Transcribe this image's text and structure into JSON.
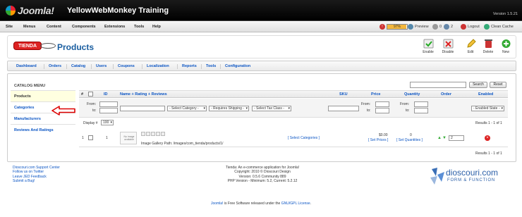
{
  "header": {
    "logo_text": "Joomla!",
    "site_title": "YellowWebMonkey Training",
    "version": "Version 1.5.21"
  },
  "menu": [
    "Site",
    "Menus",
    "Content",
    "Components",
    "Extensions",
    "Tools",
    "Help"
  ],
  "status": {
    "meter": "97%",
    "preview": "Preview",
    "messages": "0",
    "users": "2",
    "logout": "Logout",
    "clean_cache": "Clean Cache"
  },
  "toolbar": {
    "brand_label": "TIENDA",
    "page_title": "Products",
    "buttons": [
      "Enable",
      "Disable",
      "Edit",
      "Delete",
      "New"
    ]
  },
  "subnav": [
    "Dashboard",
    "Orders",
    "Catalog",
    "Users",
    "Coupons",
    "Localization",
    "Reports",
    "Tools",
    "Configuration"
  ],
  "catalog_menu": {
    "heading": "CATALOG MENU",
    "items": [
      "Products",
      "Categories",
      "Manufacturers",
      "Reviews And Ratings"
    ]
  },
  "search": {
    "search_btn": "Search",
    "reset_btn": "Reset"
  },
  "table": {
    "headers": {
      "num": "#",
      "id": "ID",
      "name": "Name + Rating + Reviews",
      "sku": "SKU",
      "price": "Price",
      "quantity": "Quantity",
      "order": "Order",
      "enabled": "Enabled"
    },
    "filters": {
      "from": "From:",
      "to": "to:",
      "category": "- Select Category -",
      "shipping": "- Requires Shipping -",
      "tax": "- Select Tax Class -",
      "enabled": "- Enabled State -"
    },
    "display": "Display #",
    "display_value": "100",
    "results": "Results 1 - 1 of 1",
    "row": {
      "num": "1",
      "id": "1",
      "thumb": "No image available",
      "gallery": "Image Gallery Path: /images/com_tienda/products/1/",
      "categories": "[ Select Categories ]",
      "price": "$0.00",
      "set_prices": "[ Set Prices ]",
      "qty": "0",
      "set_quantities": "[ Set Quantities ]",
      "order": "2"
    }
  },
  "footer": {
    "left": [
      "Dioscouri.com Support Center",
      "Follow us on Twitter",
      "Leave JED Feedback",
      "Submit a Bug!"
    ],
    "center": [
      "Tienda: An e-commerce application for Joomla!",
      "Copyright: 2010 © Dioscouri Design",
      "Version: 0.5.6 Community 889",
      "PHP Version - Minimum: 5.2, Current: 5.2.12"
    ],
    "logo_main": "dioscouri.com",
    "logo_sub": "FORM & FUNCTION",
    "license": [
      "Joomla!",
      " is Free Software released under the ",
      "GNU/GPL License",
      "."
    ]
  },
  "colors": {
    "accent": "#0b55c4",
    "brand_red": "#d22",
    "title_blue": "#1a5ea0"
  }
}
